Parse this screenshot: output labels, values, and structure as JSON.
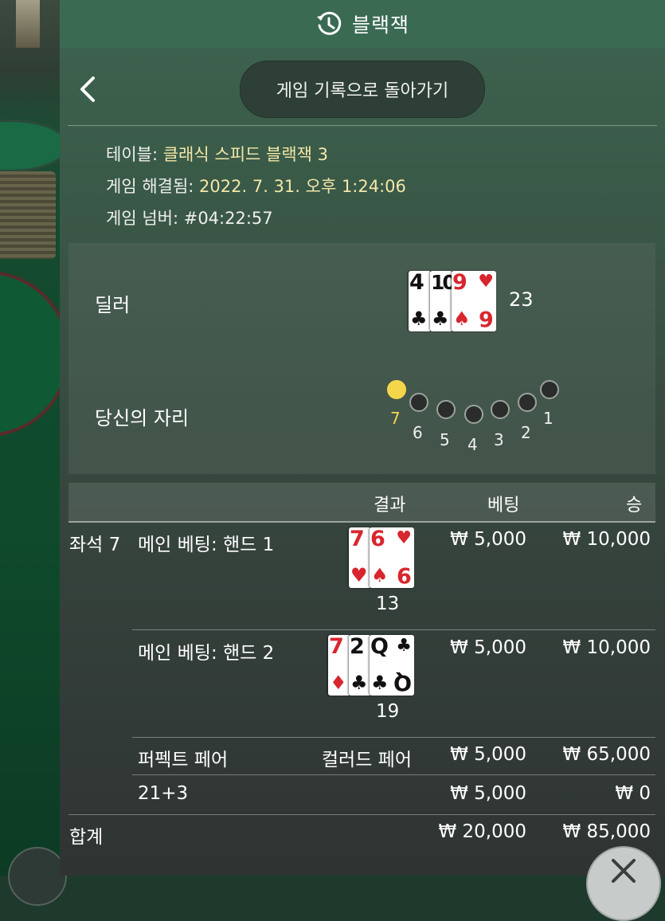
{
  "header": {
    "title": "블랙잭",
    "icon": "history-icon"
  },
  "back_button_label": "게임 기록으로 돌아가기",
  "info": {
    "table_label": "테이블:",
    "table_value": "클래식 스피드 블랙잭 3",
    "resolved_label": "게임 해결됨:",
    "resolved_value": "2022. 7. 31. 오후 1:24:06",
    "number_label": "게임 넘버:",
    "number_value": "#04:22:57"
  },
  "dealer": {
    "label": "딜러",
    "cards": [
      {
        "rank": "4",
        "suit": "♣",
        "color": "black"
      },
      {
        "rank": "10",
        "suit": "♣",
        "color": "black"
      },
      {
        "rank": "9",
        "suit": "♥",
        "color": "red"
      }
    ],
    "last_card_bottom": {
      "rank": "6",
      "suit": "♠"
    },
    "total": "23"
  },
  "seats": {
    "label": "당신의 자리",
    "numbers": [
      "7",
      "6",
      "5",
      "4",
      "3",
      "2",
      "1"
    ],
    "active": "7"
  },
  "table": {
    "headers": {
      "result": "결과",
      "bet": "베팅",
      "win": "승"
    },
    "seat_label": "좌석 7",
    "rows": [
      {
        "label": "메인 베팅: 핸드 1",
        "hand_total": "13",
        "bet": "₩ 5,000",
        "win": "₩ 10,000"
      },
      {
        "label": "메인 베팅: 핸드 2",
        "hand_total": "19",
        "bet": "₩ 5,000",
        "win": "₩ 10,000"
      },
      {
        "label": "퍼펙트 페어",
        "result": "컬러드 페어",
        "bet": "₩ 5,000",
        "win": "₩ 65,000"
      },
      {
        "label": "21+3",
        "result": "",
        "bet": "₩ 5,000",
        "win": "₩ 0"
      }
    ],
    "total": {
      "label": "합계",
      "bet": "₩ 20,000",
      "win": "₩ 85,000"
    }
  },
  "colors": {
    "accent_yellow": "#f5d64b",
    "value_text": "#f3e7a7",
    "card_red": "#d8262e"
  }
}
